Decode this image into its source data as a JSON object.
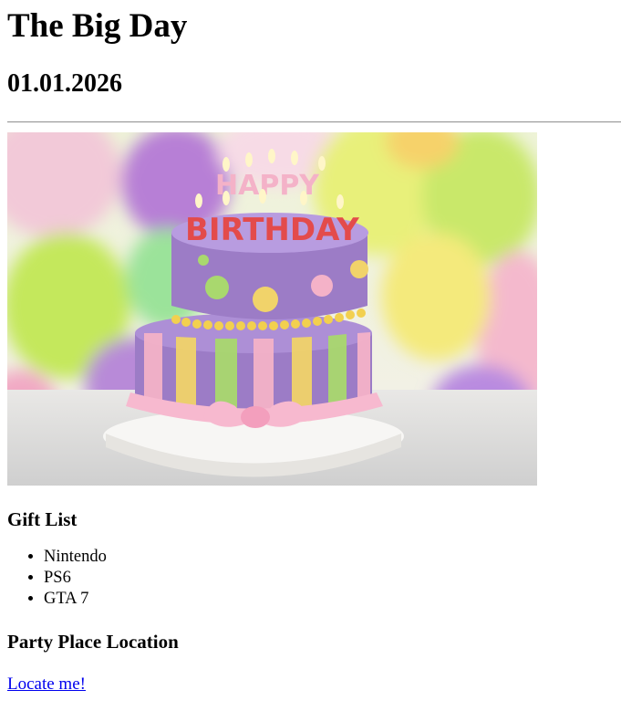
{
  "header": {
    "title": "The Big Day",
    "date": "01.01.2026"
  },
  "hero_image": {
    "icon": "birthday-cake-image",
    "candle_text_top": "HAPPY",
    "candle_text_bottom": "BIRTHDAY",
    "colors": {
      "cake_purple": "#9c7cc6",
      "stripe_yellow": "#f1d36a",
      "stripe_green": "#a9d86e",
      "stripe_pink": "#f4b2c8",
      "ribbon_pink": "#f7b9cf"
    }
  },
  "gifts": {
    "heading": "Gift List",
    "items": [
      "Nintendo",
      "PS6",
      "GTA 7"
    ]
  },
  "location": {
    "heading": "Party Place Location",
    "link_text": "Locate me!"
  },
  "colors": {
    "link": "#0000ee",
    "text": "#000000",
    "rule": "#9a9a9a"
  }
}
